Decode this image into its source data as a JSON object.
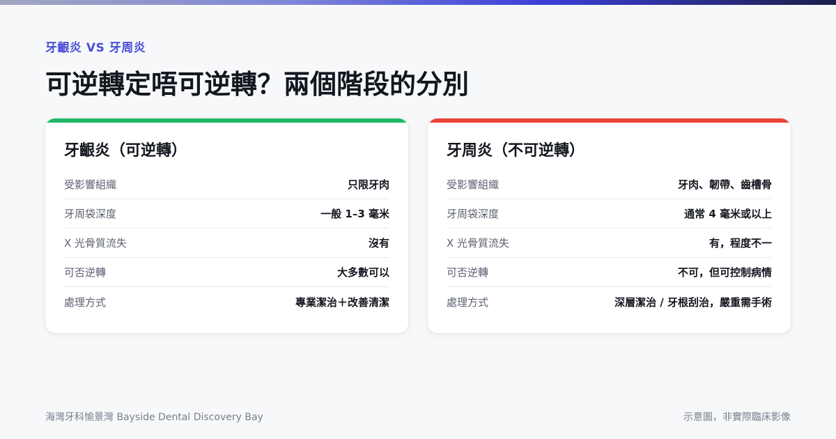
{
  "colors": {
    "accent_brand": "#4b4fd6",
    "gingivitis_accent": "#1fb866",
    "periodontitis_accent": "#e94335"
  },
  "eyebrow": "牙齦炎 VS 牙周炎",
  "title": "可逆轉定唔可逆轉？兩個階段的分別",
  "cards": [
    {
      "title": "牙齦炎（可逆轉）",
      "rows": [
        {
          "label": "受影響組織",
          "value": "只限牙肉"
        },
        {
          "label": "牙周袋深度",
          "value": "一般 1–3 毫米"
        },
        {
          "label": "X 光骨質流失",
          "value": "沒有"
        },
        {
          "label": "可否逆轉",
          "value": "大多數可以"
        },
        {
          "label": "處理方式",
          "value": "專業潔治＋改善清潔"
        }
      ]
    },
    {
      "title": "牙周炎（不可逆轉）",
      "rows": [
        {
          "label": "受影響組織",
          "value": "牙肉、韌帶、齒槽骨"
        },
        {
          "label": "牙周袋深度",
          "value": "通常 4 毫米或以上"
        },
        {
          "label": "X 光骨質流失",
          "value": "有，程度不一"
        },
        {
          "label": "可否逆轉",
          "value": "不可，但可控制病情"
        },
        {
          "label": "處理方式",
          "value": "深層潔治 / 牙根刮治，嚴重需手術"
        }
      ]
    }
  ],
  "footer": {
    "left": "海灣牙科愉景灣 Bayside Dental Discovery Bay",
    "right": "示意圖，非實際臨床影像"
  }
}
